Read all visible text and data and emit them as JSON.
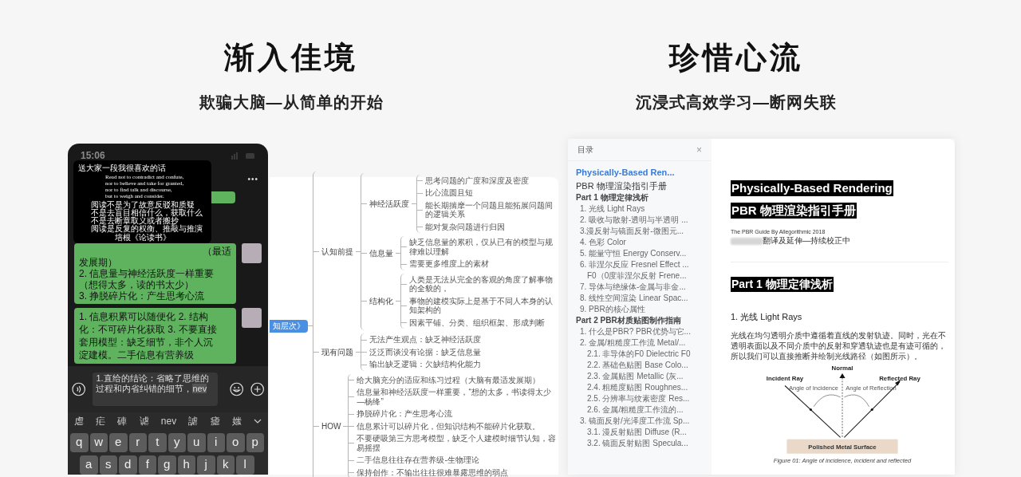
{
  "left": {
    "title": "渐入佳境",
    "subtitle": "欺骗大脑—从简单的开始"
  },
  "right": {
    "title": "珍惜心流",
    "subtitle": "沉浸式高效学习—断网失联"
  },
  "phone": {
    "status_time": "15:06",
    "menu": "•••",
    "popup": {
      "title": "送大家一段我很喜欢的话",
      "quote_en": [
        "Read not to contradict and confute,",
        "nor to believe and take for granted,",
        "nor to find talk and discourse,",
        "but to weigh and consider."
      ],
      "quote_zh": [
        "阅读不是为了故意反驳和质疑",
        "不是去盲目相信什么，获取什么",
        "不是去断章取义或者搬抄",
        "阅读是反复的权衡、推敲与推演"
      ],
      "attribution": "培根《论读书》"
    },
    "messages": [
      {
        "lines": [
          "（最适",
          "发展期）",
          "2. 信息量与神经活跃度一样重要",
          "（想得太多，读的书太少）",
          "3. 挣脱碎片化：产生思考心流"
        ]
      },
      {
        "lines": [
          "1. 信息积累可以随便化 2. 结构",
          "化：不可碎片化获取 3. 不要直接",
          "套用模型：缺乏细节，非个人沉",
          "淀建模。二手信息有营养级"
        ]
      }
    ],
    "input": {
      "value": "1.直给的结论：省略了思维的过程和内省纠错的细节，",
      "composing": "nev"
    },
    "candidates": [
      "虐",
      "疟",
      "硨",
      "谑",
      "nev",
      "謔",
      "瘧",
      "媸"
    ],
    "keyboard_rows": [
      [
        "q",
        "w",
        "e",
        "r",
        "t",
        "y",
        "u",
        "i",
        "o",
        "p"
      ],
      [
        "a",
        "s",
        "d",
        "f",
        "g",
        "h",
        "j",
        "k",
        "l"
      ]
    ]
  },
  "mindmap": {
    "root": "知层次》",
    "children": [
      {
        "label": "认知前提",
        "children": [
          {
            "label": "神经活跃度",
            "children": [
              {
                "label": "思考问题的广度和深度及密度"
              },
              {
                "label": "比心流圆且短"
              },
              {
                "label": "能长期揣摩一个问题且能拓展问题间的逻辑关系"
              },
              {
                "label": "能对复杂问题进行归因"
              }
            ]
          },
          {
            "label": "信息量",
            "children": [
              {
                "label": "缺乏信息量的累积，仅从已有的模型与规律难以理解"
              },
              {
                "label": "需要更多维度上的素材"
              }
            ]
          },
          {
            "label": "结构化",
            "children": [
              {
                "label": "人类是无法从完全的客观的角度了解事物的全貌的，"
              },
              {
                "label": "事物的建模实际上是基于不同人本身的认知架构的"
              },
              {
                "label": "因素平铺、分类、组织框架、形成判断"
              }
            ]
          }
        ]
      },
      {
        "label": "现有问题",
        "children": [
          {
            "label": "无法产生观点：缺乏神经活跃度"
          },
          {
            "label": "泛泛而谈没有论据：缺乏信息量"
          },
          {
            "label": "输出缺乏逻辑：欠缺结构化能力"
          }
        ]
      },
      {
        "label": "HOW",
        "children": [
          {
            "label": "给大脑充分的适应和练习过程（大脑有最适发展期）"
          },
          {
            "label": "信息量和神经活跃度一样重要，“想的太多，书读得太少—杨绛”"
          },
          {
            "label": "挣脱碎片化：产生思考心流"
          },
          {
            "label": "信息累计可以碎片化，但知识结构不能碎片化获取。"
          },
          {
            "label": "不要硬吸第三方思考模型，缺乏个人建模时细节认知，容易摇摆"
          },
          {
            "label": "二手信息往往存在营养级-生物理论"
          },
          {
            "label": "保持创作：不输出往往很难暴露思维的弱点"
          }
        ]
      }
    ]
  },
  "toc": {
    "title": "目录",
    "close": "×",
    "items": [
      {
        "kind": "title",
        "text": "Physically-Based Ren...",
        "selected": true
      },
      {
        "kind": "subtitle",
        "text": "PBR 物理渲染指引手册",
        "selected": false
      },
      {
        "kind": "part",
        "text": "Part 1 物理定律浅析",
        "selected": false
      },
      {
        "kind": "item",
        "text": "1. 光线 Light Rays",
        "selected": false
      },
      {
        "kind": "item",
        "text": "2. 吸收与散射-透明与半透明 ...",
        "selected": false
      },
      {
        "kind": "item",
        "text": "3.漫反射与镜面反射-微图元...",
        "selected": false
      },
      {
        "kind": "item",
        "text": "4. 色彩 Color",
        "selected": false
      },
      {
        "kind": "item",
        "text": "5. 能量守恒 Energy Conserv...",
        "selected": false
      },
      {
        "kind": "item",
        "text": "6. 菲涅尔反应 Fresnel Effect ...",
        "selected": false
      },
      {
        "kind": "subitem",
        "text": "F0（0度菲涅尔反射 Frene...",
        "selected": false
      },
      {
        "kind": "item",
        "text": "7. 导体与绝缘体-金属与非金...",
        "selected": false
      },
      {
        "kind": "item",
        "text": "8. 线性空间渲染 Linear Spac...",
        "selected": false
      },
      {
        "kind": "item",
        "text": "9. PBR的核心属性",
        "selected": false
      },
      {
        "kind": "part",
        "text": "Part 2 PBR材质贴图制作指南",
        "selected": false
      },
      {
        "kind": "item",
        "text": "1. 什么是PBR? PBR优势与它...",
        "selected": false
      },
      {
        "kind": "item",
        "text": "2. 金属/粗糙度工作流 Metal/...",
        "selected": false
      },
      {
        "kind": "subitem",
        "text": "2.1. 非导体的F0 Dielectric F0",
        "selected": false
      },
      {
        "kind": "subitem",
        "text": "2.2. 基础色贴图 Base Colo...",
        "selected": false
      },
      {
        "kind": "subitem",
        "text": "2.3. 金属贴图 Metallic (灰...",
        "selected": false
      },
      {
        "kind": "subitem",
        "text": "2.4. 粗糙度贴图 Roughnes...",
        "selected": false
      },
      {
        "kind": "subitem",
        "text": "2.5. 分辨率与纹素密度 Res...",
        "selected": false
      },
      {
        "kind": "subitem",
        "text": "2.6. 金属/粗糙度工作流的...",
        "selected": false
      },
      {
        "kind": "item",
        "text": "3. 镜面反射/光泽度工作流 Sp...",
        "selected": false
      },
      {
        "kind": "subitem",
        "text": "3.1. 漫反射贴图 Diffuse (R...",
        "selected": false
      },
      {
        "kind": "subitem",
        "text": "3.2. 镜面反射贴图 Specula...",
        "selected": false
      }
    ]
  },
  "document": {
    "title_en": "Physically-Based Rendering",
    "title_zh": "PBR 物理渲染指引手册",
    "credit": "The PBR Guide By Allegorithmic 2018",
    "translator_note": "翻译及延伸—持续校正中",
    "part_heading": "Part 1 物理定律浅析",
    "section_heading": "1. 光线 Light Rays",
    "paragraph": "光线在均匀透明介质中遵循着直线的发射轨迹。同时，光在不透明表面以及不同介质中的反射和穿透轨迹也是有迹可循的，所以我们可以直接推断并绘制光线路径（如图所示）。",
    "figure": {
      "normal_label": "Normal",
      "incident_label": "Incident Ray",
      "reflected_label": "Reflected Ray",
      "angle_incidence_label": "Angle of Incidence",
      "angle_reflection_label": "Angle of Reflection",
      "surface_label": "Polished Metal Surface",
      "caption": "Figure 01: Angle of incidence, incident and reflected"
    }
  }
}
